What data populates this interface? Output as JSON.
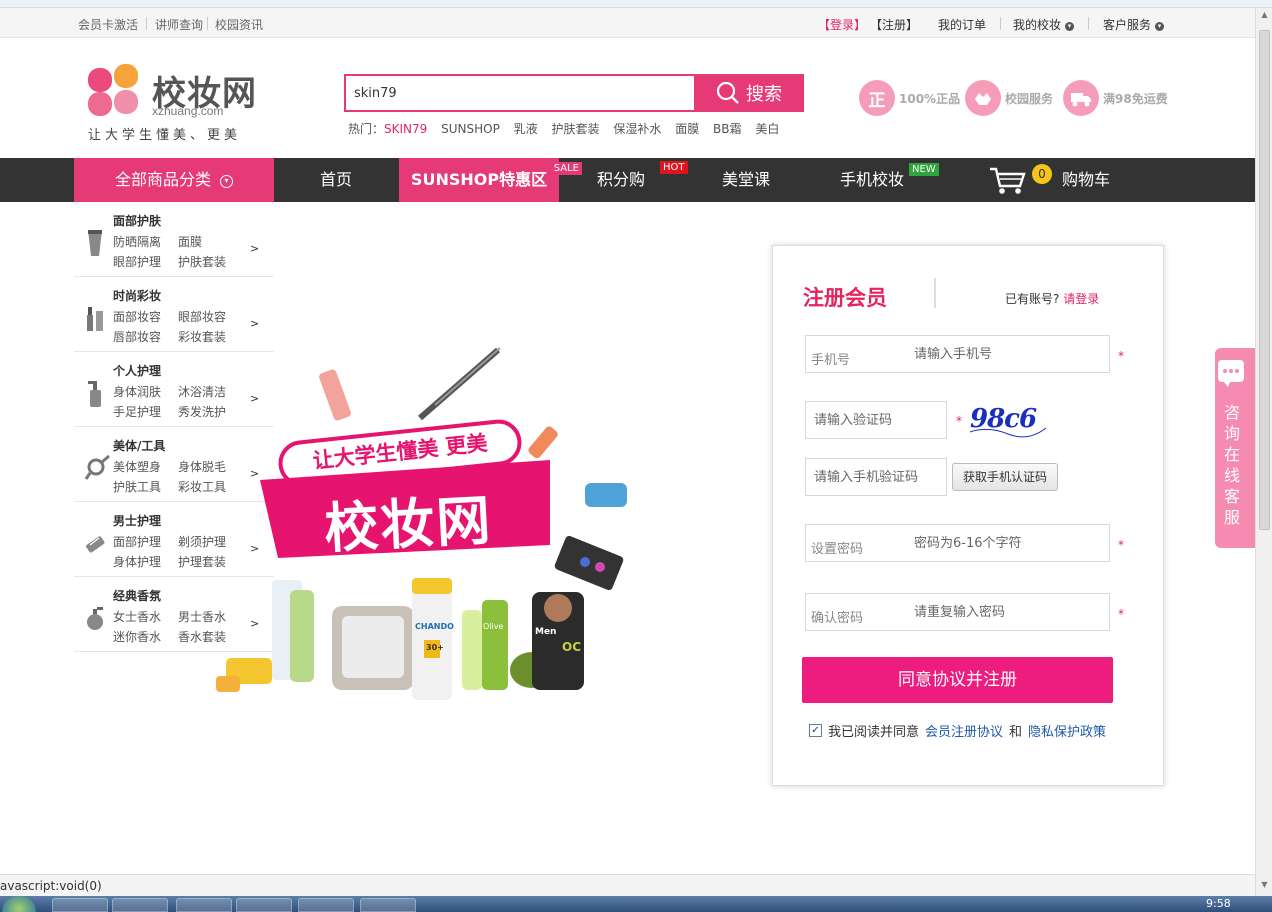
{
  "topbar": {
    "left": [
      "会员卡激活",
      "讲师查询",
      "校园资讯"
    ],
    "login": "【登录】",
    "register": "【注册】",
    "my_orders": "我的订单",
    "my_school": "我的校妆",
    "customer_service": "客户服务"
  },
  "logo": {
    "name": "校妆网",
    "url": "xzhuang.com",
    "slogan": "让大学生懂美、更美"
  },
  "search": {
    "value": "skin79",
    "button": "搜索",
    "hot_label": "热门：",
    "hot": [
      "SKIN79",
      "SUNSHOP",
      "乳液",
      "护肤套装",
      "保湿补水",
      "面膜",
      "BB霜",
      "美白"
    ]
  },
  "guarantees": [
    {
      "icon": "正",
      "label": "100%正品"
    },
    {
      "icon": "校",
      "label": "校园服务"
    },
    {
      "icon": "运",
      "label": "满98免运费"
    }
  ],
  "nav": {
    "all": "全部商品分类",
    "home": "首页",
    "sunshop": "SUNSHOP特惠区",
    "sale_tag": "SALE",
    "points": "积分购",
    "hot_tag": "HOT",
    "beauty_class": "美堂课",
    "mobile": "手机校妆",
    "new_tag": "NEW",
    "cart_count": "0",
    "cart": "购物车"
  },
  "categories": [
    {
      "title": "面部护肤",
      "subs": [
        "防晒隔离",
        "面膜",
        "眼部护理",
        "护肤套装"
      ]
    },
    {
      "title": "时尚彩妆",
      "subs": [
        "面部妆容",
        "眼部妆容",
        "唇部妆容",
        "彩妆套装"
      ]
    },
    {
      "title": "个人护理",
      "subs": [
        "身体润肤",
        "沐浴清洁",
        "手足护理",
        "秀发洗护"
      ]
    },
    {
      "title": "美体/工具",
      "subs": [
        "美体塑身",
        "身体脱毛",
        "护肤工具",
        "彩妆工具"
      ]
    },
    {
      "title": "男士护理",
      "subs": [
        "面部护理",
        "剃须护理",
        "身体护理",
        "护理套装"
      ]
    },
    {
      "title": "经典香氛",
      "subs": [
        "女士香水",
        "男士香水",
        "迷你香水",
        "香水套装"
      ]
    }
  ],
  "banner": {
    "slogan": "让大学生懂美 更美",
    "brand": "校妆网",
    "products": [
      "CHANDO",
      "30+",
      "Olive",
      "Men",
      "OC"
    ]
  },
  "register": {
    "title": "注册会员",
    "has_account": "已有账号?",
    "login_link": "请登录",
    "phone_label": "手机号",
    "phone_placeholder": "请输入手机号",
    "captcha_placeholder": "请输入验证码",
    "captcha_text": "98c6",
    "sms_placeholder": "请输入手机验证码",
    "sms_button": "获取手机认证码",
    "pwd_label": "设置密码",
    "pwd_placeholder": "密码为6-16个字符",
    "pwd2_label": "确认密码",
    "pwd2_placeholder": "请重复输入密码",
    "required": "*",
    "submit": "同意协议并注册",
    "agree_text": "我已阅读并同意",
    "agreement": "会员注册协议",
    "and": "和",
    "privacy": "隐私保护政策"
  },
  "service": {
    "chars": [
      "咨",
      "询",
      "在",
      "线",
      "客",
      "服"
    ]
  },
  "status": "avascript:void(0)",
  "clock": "9:58",
  "colors": {
    "brand": "#e63a77",
    "submit": "#ed1d7f",
    "nav_bg": "#333333"
  }
}
